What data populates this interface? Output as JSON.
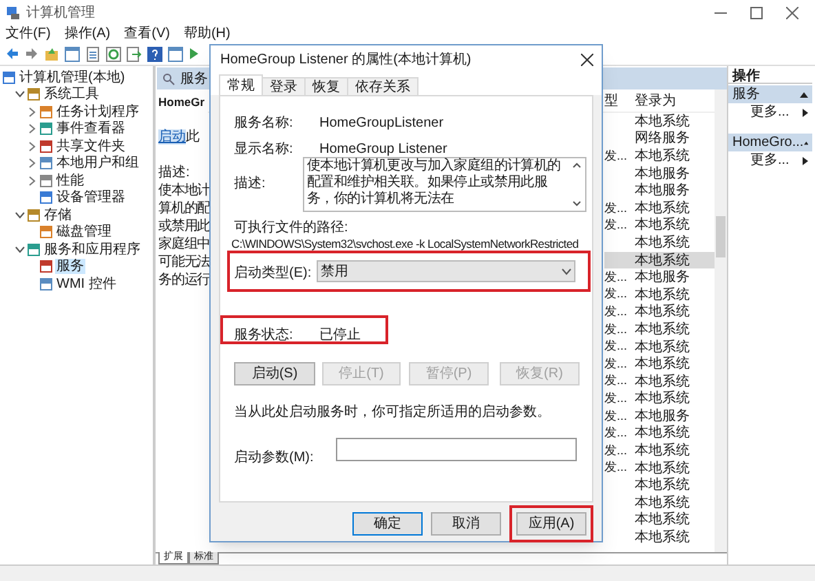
{
  "window": {
    "title": "计算机管理"
  },
  "menu": [
    "文件(F)",
    "操作(A)",
    "查看(V)",
    "帮助(H)"
  ],
  "tree": [
    {
      "label": "计算机管理(本地)",
      "selected": false,
      "children": [
        {
          "label": "系统工具",
          "expanded": true,
          "selected": false,
          "children": [
            {
              "label": "任务计划程序",
              "expanded": false,
              "selected": false
            },
            {
              "label": "事件查看器",
              "expanded": false,
              "selected": false
            },
            {
              "label": "共享文件夹",
              "expanded": false,
              "selected": false
            },
            {
              "label": "本地用户和组",
              "expanded": false,
              "selected": false
            },
            {
              "label": "性能",
              "expanded": false,
              "selected": false
            },
            {
              "label": "设备管理器",
              "selected": false
            }
          ]
        },
        {
          "label": "存储",
          "expanded": true,
          "selected": false,
          "children": [
            {
              "label": "磁盘管理",
              "selected": false
            }
          ]
        },
        {
          "label": "服务和应用程序",
          "expanded": true,
          "selected": false,
          "children": [
            {
              "label": "服务",
              "selected": true
            },
            {
              "label": "WMI 控件",
              "selected": false
            }
          ]
        }
      ]
    }
  ],
  "services_panel": {
    "title": "服务",
    "service_name": "HomeGr",
    "start_link": "启动",
    "start_text": "此",
    "description_label": "描述:",
    "description_lines": [
      "使本地计",
      "算机的配",
      "或禁用此",
      "家庭组中",
      "可能无法",
      "务的运行"
    ],
    "columns": [
      "型",
      "登录为"
    ],
    "rows": [
      {
        "column_1": "",
        "login_as": "本地系统",
        "selected": false
      },
      {
        "column_1": "",
        "login_as": "网络服务",
        "selected": false
      },
      {
        "column_1": "发...",
        "login_as": "本地系统",
        "selected": false
      },
      {
        "column_1": "",
        "login_as": "本地服务",
        "selected": false
      },
      {
        "column_1": "",
        "login_as": "本地服务",
        "selected": false
      },
      {
        "column_1": "发...",
        "login_as": "本地系统",
        "selected": false
      },
      {
        "column_1": "发...",
        "login_as": "本地系统",
        "selected": false
      },
      {
        "column_1": "",
        "login_as": "本地系统",
        "selected": false
      },
      {
        "column_1": "",
        "login_as": "本地系统",
        "selected": true
      },
      {
        "column_1": "发...",
        "login_as": "本地服务",
        "selected": false
      },
      {
        "column_1": "发...",
        "login_as": "本地系统",
        "selected": false
      },
      {
        "column_1": "发...",
        "login_as": "本地系统",
        "selected": false
      },
      {
        "column_1": "发...",
        "login_as": "本地系统",
        "selected": false
      },
      {
        "column_1": "发...",
        "login_as": "本地系统",
        "selected": false
      },
      {
        "column_1": "发...",
        "login_as": "本地系统",
        "selected": false
      },
      {
        "column_1": "发...",
        "login_as": "本地系统",
        "selected": false
      },
      {
        "column_1": "发...",
        "login_as": "本地系统",
        "selected": false
      },
      {
        "column_1": "发...",
        "login_as": "本地服务",
        "selected": false
      },
      {
        "column_1": "发...",
        "login_as": "本地系统",
        "selected": false
      },
      {
        "column_1": "发...",
        "login_as": "本地系统",
        "selected": false
      },
      {
        "column_1": "发...",
        "login_as": "本地系统",
        "selected": false
      },
      {
        "column_1": "",
        "login_as": "本地系统",
        "selected": false
      },
      {
        "column_1": "",
        "login_as": "本地系统",
        "selected": false
      },
      {
        "column_1": "",
        "login_as": "本地系统",
        "selected": false
      },
      {
        "column_1": "",
        "login_as": "本地系统",
        "selected": false
      }
    ],
    "view_tabs": [
      {
        "label": "扩展",
        "selected": true
      },
      {
        "label": "标准",
        "selected": false
      }
    ]
  },
  "actions": {
    "title": "操作",
    "groups": [
      {
        "label": "服务",
        "more": "更多..."
      },
      {
        "label": "HomeGro...",
        "more": "更多..."
      }
    ]
  },
  "dialog": {
    "title": "HomeGroup Listener 的属性(本地计算机)",
    "tabs": [
      {
        "label": "常规",
        "selected": true
      },
      {
        "label": "登录",
        "selected": false
      },
      {
        "label": "恢复",
        "selected": false
      },
      {
        "label": "依存关系",
        "selected": false
      }
    ],
    "service_name_label": "服务名称:",
    "service_name": "HomeGroupListener",
    "display_name_label": "显示名称:",
    "display_name": "HomeGroup Listener",
    "description_label": "描述:",
    "description": "使本地计算机更改与加入家庭组的计算机的配置和维护相关联。如果停止或禁用此服务，你的计算机将无法在",
    "path_label": "可执行文件的路径:",
    "path": "C:\\WINDOWS\\System32\\svchost.exe -k LocalSystemNetworkRestricted",
    "startup_type_label": "启动类型(E):",
    "startup_type": "禁用",
    "status_label": "服务状态:",
    "status": "已停止",
    "service_buttons": [
      {
        "label": "启动(S)",
        "disabled": false
      },
      {
        "label": "停止(T)",
        "disabled": true
      },
      {
        "label": "暂停(P)",
        "disabled": true
      },
      {
        "label": "恢复(R)",
        "disabled": true
      }
    ],
    "hint": "当从此处启动服务时，你可指定所适用的启动参数。",
    "params_label": "启动参数(M):",
    "buttons": [
      {
        "label": "确定",
        "default": true
      },
      {
        "label": "取消",
        "default": false
      },
      {
        "label": "应用(A)",
        "default": false
      }
    ]
  }
}
